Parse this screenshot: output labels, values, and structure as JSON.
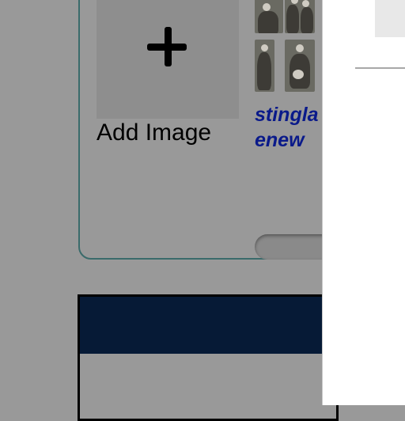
{
  "gallery": {
    "add_image_label": "Add Image",
    "add_icon": "plus-icon",
    "title_line1": "stingla",
    "title_line2": "enew",
    "title_color": "#0a1a8a"
  },
  "colors": {
    "overlay_background": "#999999",
    "card_border": "#3a6b6b",
    "lower_header": "#061a36",
    "drawer_background": "#ffffff"
  }
}
